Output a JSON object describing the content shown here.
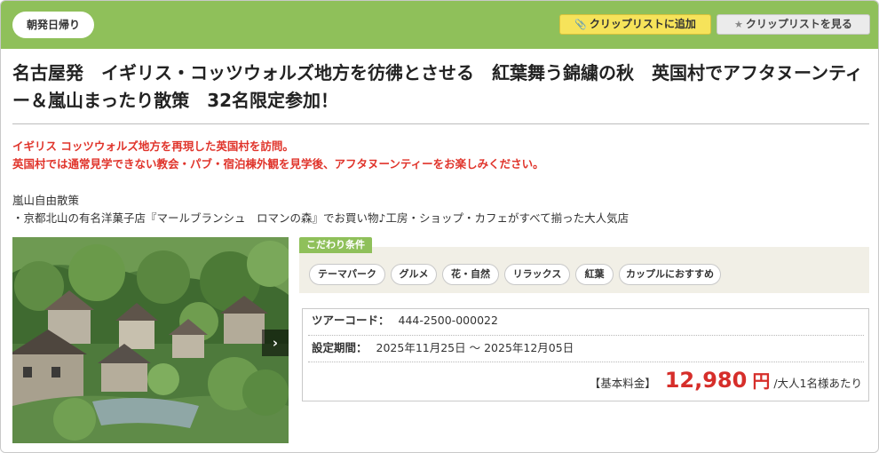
{
  "header": {
    "tag": "朝発日帰り",
    "clip_add_label": "クリップリストに追加",
    "clip_view_label": "クリップリストを見る"
  },
  "tour": {
    "title": "名古屋発　イギリス・コッツウォルズ地方を彷彿とさせる　紅葉舞う錦繍の秋　英国村でアフタヌーンティー＆嵐山まったり散策　32名限定参加！",
    "lead_lines": [
      "イギリス コッツウォルズ地方を再現した英国村を訪問。",
      "英国村では通常見学できない教会・パブ・宿泊棟外観を見学後、アフタヌーンティーをお楽しみください。"
    ],
    "desc_lines": [
      "嵐山自由散策",
      "・京都北山の有名洋菓子店『マールブランシュ　ロマンの森』でお買い物♪工房・ショップ・カフェがすべて揃った大人気店"
    ]
  },
  "photo": {
    "next_glyph": "›"
  },
  "kodawari": {
    "label": "こだわり条件",
    "chips": [
      "テーマパーク",
      "グルメ",
      "花・自然",
      "リラックス",
      "紅葉",
      "カップルにおすすめ"
    ]
  },
  "info": {
    "code_label": "ツアーコード：",
    "code_value": "444-2500-000022",
    "period_label": "設定期間：",
    "period_value": "2025年11月25日 ～ 2025年12月05日",
    "price_label": "【基本料金】",
    "price_value": "12,980",
    "price_unit": "円",
    "price_note": "/大人1名様あたり"
  },
  "colors": {
    "header_green": "#8fc05a",
    "lead_red": "#e0342b",
    "price_red": "#d62e2a",
    "clip_yellow": "#f6e35a"
  },
  "icons": {
    "clip_add": "paperclip-icon",
    "clip_view": "star-icon",
    "photo_next": "chevron-right-icon"
  }
}
